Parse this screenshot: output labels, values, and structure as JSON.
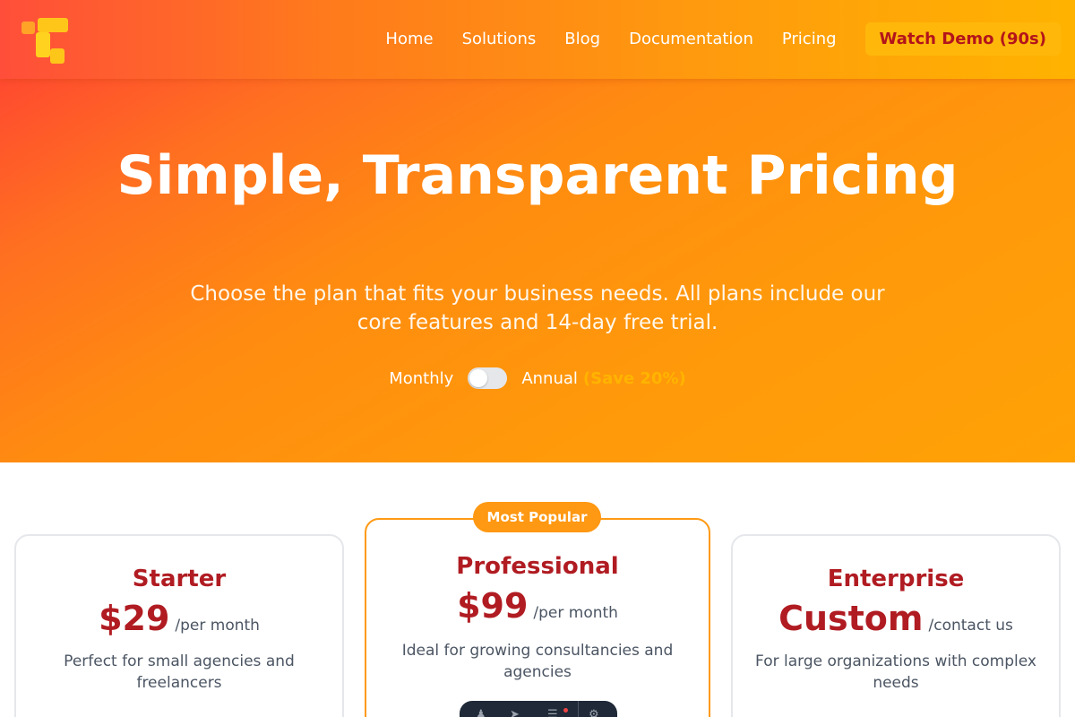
{
  "nav": {
    "links": [
      "Home",
      "Solutions",
      "Blog",
      "Documentation",
      "Pricing"
    ],
    "cta": "Watch Demo (90s)"
  },
  "hero": {
    "title": "Simple, Transparent Pricing",
    "subtitle": "Choose the plan that fits your business needs. All plans include our core features and 14-day free trial.",
    "toggle": {
      "monthly": "Monthly",
      "annual": "Annual",
      "save": "(Save 20%)",
      "annual_enabled": false
    }
  },
  "plans": [
    {
      "name": "Starter",
      "price": "$29",
      "period": "/per month",
      "description": "Perfect for small agencies and freelancers"
    },
    {
      "name": "Professional",
      "badge": "Most Popular",
      "price": "$99",
      "period": "/per month",
      "description": "Ideal for growing consultancies and agencies"
    },
    {
      "name": "Enterprise",
      "price": "Custom",
      "period": "/contact us",
      "description": "For large organizations with complex needs"
    }
  ],
  "colors": {
    "brand_red": "#b01c22",
    "brand_orange": "#ff9812",
    "accent_yellow": "#ffb400"
  }
}
